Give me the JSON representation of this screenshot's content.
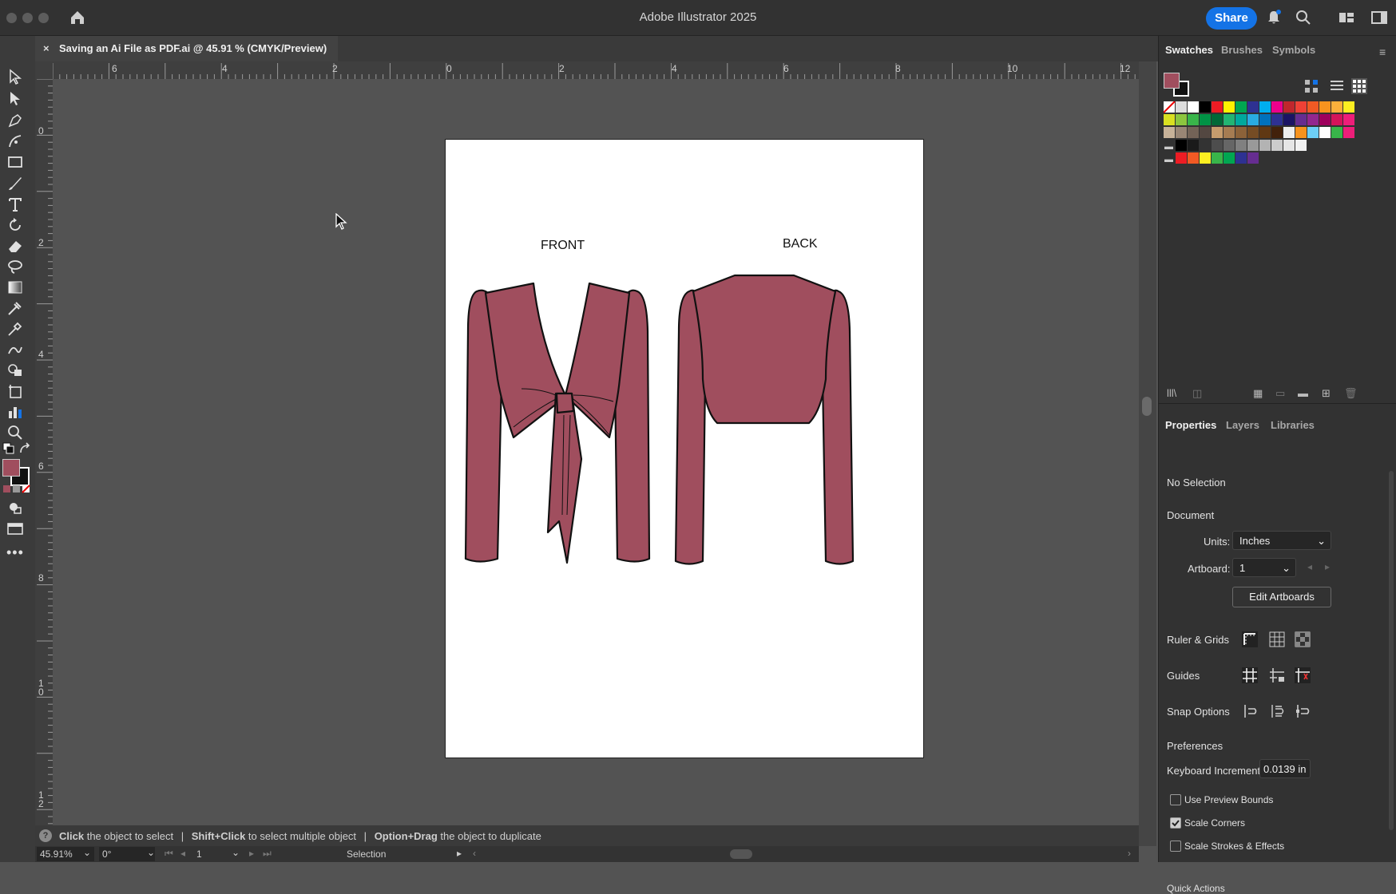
{
  "window": {
    "title": "Adobe Illustrator 2025",
    "share_label": "Share"
  },
  "document_tab": {
    "title": "Saving an Ai File as PDF.ai @ 45.91 % (CMYK/Preview)",
    "close": "×"
  },
  "ruler_top": [
    "6",
    "4",
    "2",
    "0",
    "2",
    "4",
    "6",
    "8",
    "10",
    "12"
  ],
  "ruler_left": [
    "0",
    "2",
    "4",
    "6",
    "8",
    "1\n0",
    "1\n2"
  ],
  "artboard": {
    "front_label": "FRONT",
    "back_label": "BACK",
    "garment_color": "#a04e5e"
  },
  "status": {
    "help_icon": "?",
    "hint_1_bold": "Click",
    "hint_1": "the object to select",
    "hint_2_bold": "Shift+Click",
    "hint_2": "to select multiple object",
    "hint_3_bold": "Option+Drag",
    "hint_3": "the object to duplicate",
    "zoom": "45.91%",
    "rotation": "0°",
    "artboard_num": "1",
    "tool": "Selection"
  },
  "swatches_panel": {
    "tabs": [
      "Swatches",
      "Brushes",
      "Symbols"
    ],
    "fill_color": "#a04e5e"
  },
  "properties_panel": {
    "tabs": [
      "Properties",
      "Layers",
      "Libraries"
    ],
    "selection": "No Selection",
    "document_heading": "Document",
    "units_label": "Units:",
    "units_value": "Inches",
    "artboard_label": "Artboard:",
    "artboard_value": "1",
    "edit_artboards": "Edit Artboards",
    "ruler_grids": "Ruler & Grids",
    "guides": "Guides",
    "snap_options": "Snap Options",
    "preferences": "Preferences",
    "keyboard_increment_label": "Keyboard Increment:",
    "keyboard_increment_value": "0.0139 in",
    "use_preview_bounds": "Use Preview Bounds",
    "scale_corners": "Scale Corners",
    "scale_strokes": "Scale Strokes & Effects",
    "quick_actions": "Quick Actions"
  },
  "checkbox_state": {
    "use_preview_bounds": false,
    "scale_corners": true,
    "scale_strokes": false
  }
}
